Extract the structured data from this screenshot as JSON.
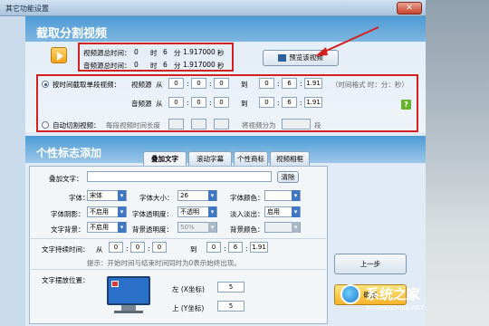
{
  "window": {
    "title": "其它功能设置",
    "close_icon": "✕"
  },
  "split": {
    "header": "截取分割视频",
    "video_total_label": "视频源总时间：",
    "video_total": [
      "0",
      "时",
      "6",
      "分",
      "1.917000",
      "秒"
    ],
    "audio_total_label": "音频源总时间：",
    "audio_total": [
      "0",
      "时",
      "6",
      "分",
      "1.917000",
      "秒"
    ],
    "preview_button": "预览该视频",
    "mode1_label": "按时间截取单段视频：",
    "video_src_label": "视频源",
    "audio_src_label": "音频源",
    "from_label": "从",
    "to_label": "到",
    "video_from": [
      "0",
      "0",
      "0"
    ],
    "video_to": [
      "0",
      "6",
      "1.91"
    ],
    "audio_from": [
      "0",
      "0",
      "0"
    ],
    "audio_to": [
      "0",
      "6",
      "1.91"
    ],
    "format_hint": "（时间格式 时：分：秒）",
    "help_icon": "?",
    "mode2_label": "自动切割视频：",
    "mode2_seg_label": "每段视频时间长度",
    "mode2_split_label": "将视频分为",
    "mode2_unit": "段"
  },
  "logo": {
    "header": "个性标志添加",
    "tabs": [
      "叠加文字",
      "滚动字幕",
      "个性商标",
      "视频相框"
    ],
    "active_tab": 0,
    "overlay_text_label": "叠加文字：",
    "overlay_text_value": "",
    "clear_button": "清除",
    "font_label": "字体：",
    "font_value": "宋体",
    "font_size_label": "字体大小：",
    "font_size_value": "26",
    "font_color_label": "字体颜色：",
    "shadow_label": "字体阴影：",
    "shadow_value": "不启用",
    "opacity_label": "字体透明度：",
    "opacity_value": "不透明",
    "fade_label": "淡入淡出：",
    "fade_value": "启用",
    "bg_label": "文字背景：",
    "bg_value": "不启用",
    "bg_opacity_label": "背景透明度：",
    "bg_opacity_value": "50%",
    "bg_color_label": "背景颜色：",
    "duration_label": "文字持续时间：",
    "duration_from": "从",
    "duration_to": "到",
    "dur_from": [
      "0",
      "0",
      "0"
    ],
    "dur_to": [
      "0",
      "6",
      "1.91"
    ],
    "duration_tip": "提示：开始时间与结束时间同时为0表示始终出现。",
    "position_label": "文字摆放位置：",
    "left_label": "左 (X坐标)",
    "left_value": "5",
    "top_label": "上 (Y坐标)",
    "top_value": "5"
  },
  "actions": {
    "prev_step": "上一步",
    "ok": "确定"
  },
  "watermark": {
    "brand": "系统之家",
    "url": "XITONGZHIJIA.NET"
  },
  "colors": {
    "redbox": "#d42020",
    "header_blue": "#4d9bd6",
    "help_green": "#68b32c"
  }
}
